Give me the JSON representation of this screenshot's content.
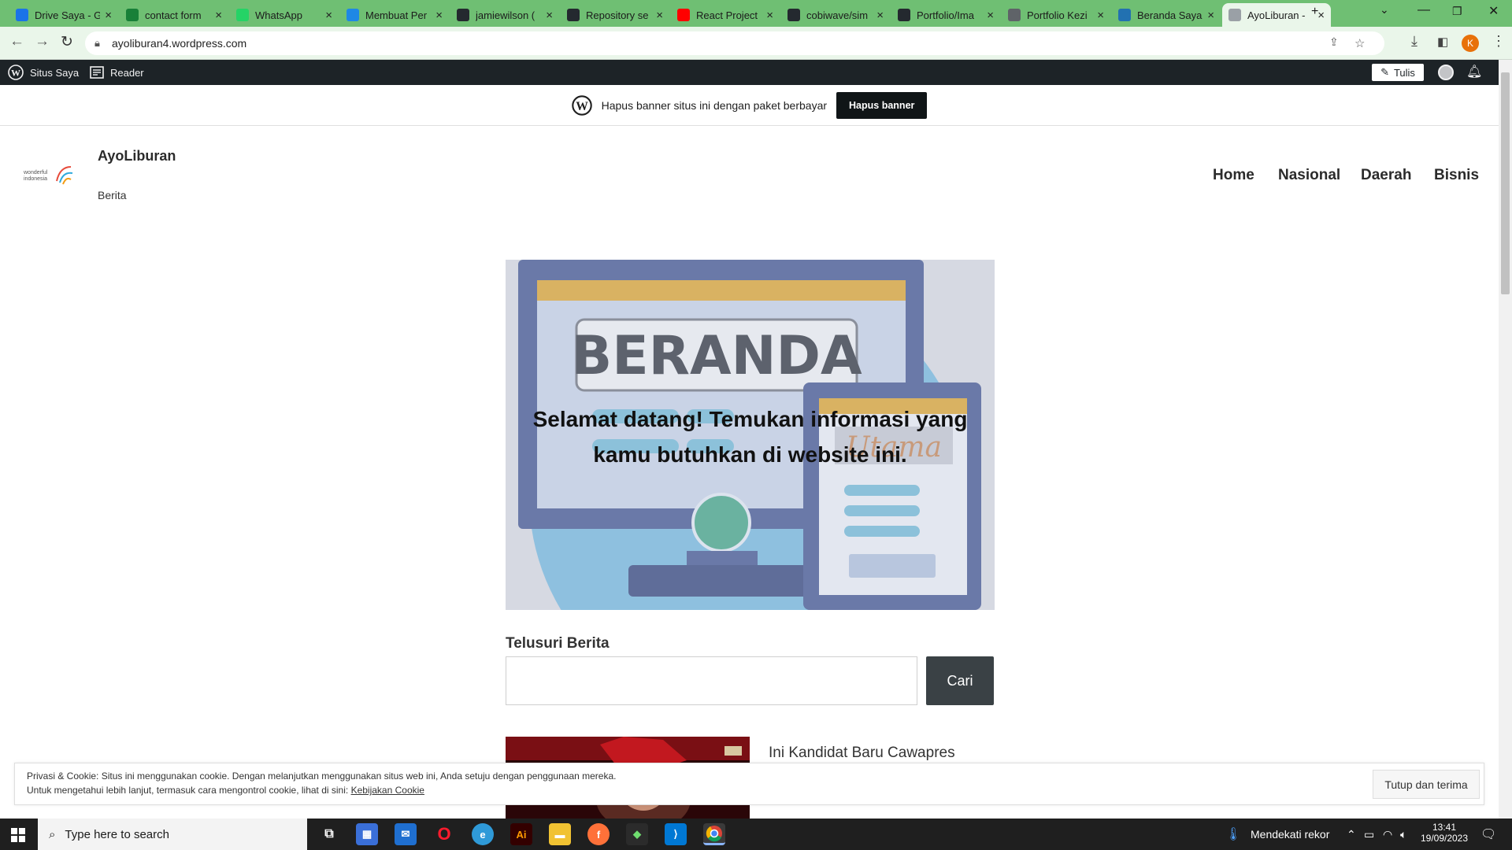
{
  "browser": {
    "tabs": [
      {
        "title": "Drive Saya - G",
        "icon": "google-drive-icon",
        "color": "#1a73e8"
      },
      {
        "title": "contact form",
        "icon": "google-sheets-icon",
        "color": "#188038"
      },
      {
        "title": "WhatsApp",
        "icon": "whatsapp-icon",
        "color": "#25d366"
      },
      {
        "title": "Membuat Per",
        "icon": "site-icon",
        "color": "#1e88e5"
      },
      {
        "title": "jamiewilson (",
        "icon": "github-icon",
        "color": "#24292f"
      },
      {
        "title": "Repository se",
        "icon": "github-icon",
        "color": "#24292f"
      },
      {
        "title": "React Project",
        "icon": "youtube-icon",
        "color": "#ff0000"
      },
      {
        "title": "cobiwave/sim",
        "icon": "github-icon",
        "color": "#24292f"
      },
      {
        "title": "Portfolio/Ima",
        "icon": "github-icon",
        "color": "#24292f"
      },
      {
        "title": "Portfolio Kezi",
        "icon": "globe-icon",
        "color": "#5f6368"
      },
      {
        "title": "Beranda Saya",
        "icon": "wordpress-icon",
        "color": "#2271b1"
      },
      {
        "title": "AyoLiburan -",
        "icon": "page-icon",
        "color": "#9aa0a6"
      }
    ],
    "url": "ayoliburan4.wordpress.com",
    "profile_letter": "K"
  },
  "wp_admin": {
    "my_site": "Situs Saya",
    "reader": "Reader",
    "write": "Tulis"
  },
  "banner": {
    "text": "Hapus banner situs ini dengan paket berbayar",
    "button": "Hapus banner"
  },
  "site": {
    "title": "AyoLiburan",
    "tagline": "Berita",
    "logo_text_1": "wonderful",
    "logo_text_2": "indonesia",
    "nav": [
      "Home",
      "Nasional",
      "Daerah",
      "Bisnis"
    ]
  },
  "hero": {
    "image_word": "BERANDA",
    "image_word_2": "Utama",
    "heading": "Selamat datang! Temukan informasi yang kamu butuhkan di website ini."
  },
  "search": {
    "label": "Telusuri Berita",
    "placeholder": "",
    "button": "Cari"
  },
  "post": {
    "title": "Ini Kandidat Baru Cawapres"
  },
  "cookie": {
    "line1": "Privasi & Cookie: Situs ini menggunakan cookie. Dengan melanjutkan menggunakan situs web ini, Anda setuju dengan penggunaan mereka.",
    "line2_prefix": "Untuk mengetahui lebih lanjut, termasuk cara mengontrol cookie, lihat di sini:",
    "line2_link": "Kebijakan Cookie",
    "button": "Tutup dan terima"
  },
  "taskbar": {
    "search_placeholder": "Type here to search",
    "weather": "Mendekati rekor",
    "time": "13:41",
    "date": "19/09/2023"
  }
}
